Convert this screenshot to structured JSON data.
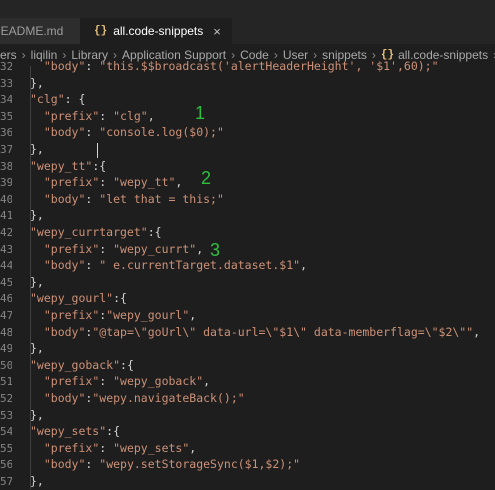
{
  "tabs": [
    {
      "label": "README.md",
      "active": false
    },
    {
      "label": "all.code-snippets",
      "active": true,
      "close_glyph": "×"
    }
  ],
  "breadcrumb": [
    "ers",
    "liqilin",
    "Library",
    "Application Support",
    "Code",
    "User",
    "snippets",
    "all.code-snippets"
  ],
  "breadcrumb_more": "...",
  "lines": [
    {
      "n": "32",
      "text": "  \"body\": \"this.$$broadcast('alertHeaderHeight', '$1',60);\""
    },
    {
      "n": "33",
      "text": "},"
    },
    {
      "n": "34",
      "text": "\"clg\": {"
    },
    {
      "n": "35",
      "text": "  \"prefix\": \"clg\","
    },
    {
      "n": "36",
      "text": "  \"body\": \"console.log($0);\""
    },
    {
      "n": "37",
      "text": "},"
    },
    {
      "n": "38",
      "text": "\"wepy_tt\":{"
    },
    {
      "n": "39",
      "text": "  \"prefix\": \"wepy_tt\","
    },
    {
      "n": "40",
      "text": "  \"body\": \"let that = this;\""
    },
    {
      "n": "41",
      "text": "},"
    },
    {
      "n": "42",
      "text": "\"wepy_currtarget\":{"
    },
    {
      "n": "43",
      "text": "  \"prefix\": \"wepy_currt\","
    },
    {
      "n": "44",
      "text": "  \"body\": \" e.currentTarget.dataset.$1\","
    },
    {
      "n": "45",
      "text": "},"
    },
    {
      "n": "46",
      "text": "\"wepy_gourl\":{"
    },
    {
      "n": "47",
      "text": "  \"prefix\":\"wepy_gourl\","
    },
    {
      "n": "48",
      "text": "  \"body\":\"@tap=\\\"goUrl\\\" data-url=\\\"$1\\\" data-memberflag=\\\"$2\\\"\","
    },
    {
      "n": "49",
      "text": "},"
    },
    {
      "n": "50",
      "text": "\"wepy_goback\":{"
    },
    {
      "n": "51",
      "text": "  \"prefix\": \"wepy_goback\","
    },
    {
      "n": "52",
      "text": "  \"body\":\"wepy.navigateBack();\""
    },
    {
      "n": "53",
      "text": "},"
    },
    {
      "n": "54",
      "text": "\"wepy_sets\":{"
    },
    {
      "n": "55",
      "text": "  \"prefix\": \"wepy_sets\","
    },
    {
      "n": "56",
      "text": "  \"body\": \"wepy.setStorageSync($1,$2);\""
    },
    {
      "n": "57",
      "text": "},"
    }
  ],
  "annotations": [
    "1",
    "2",
    "3"
  ],
  "colors": {
    "editor_bg": "#1e1e1e",
    "tabbar_bg": "#252526",
    "string": "#ce9178",
    "punctuation": "#d4d4d4",
    "line_number": "#858585",
    "annotation": "#2fbf3f",
    "json_icon": "#e5c07b"
  }
}
